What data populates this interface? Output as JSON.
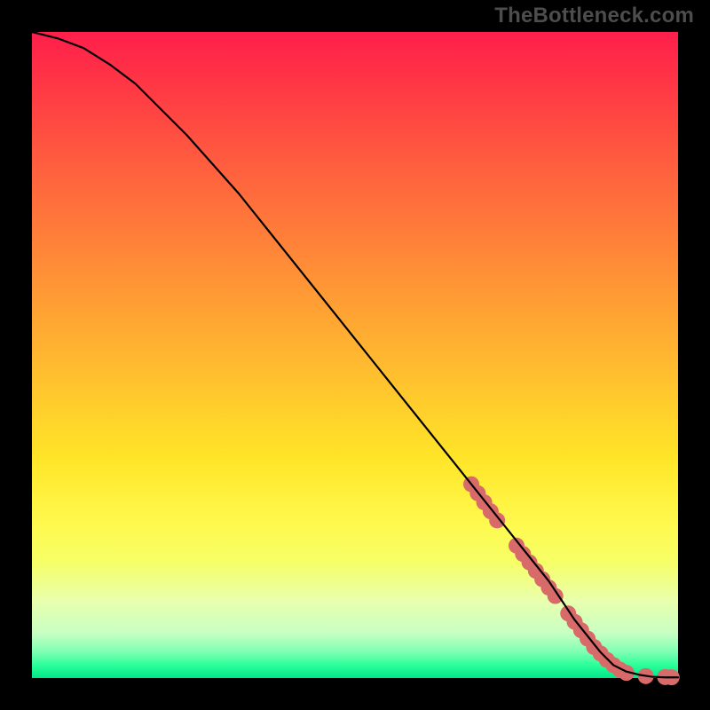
{
  "watermark": "TheBottleneck.com",
  "chart_data": {
    "type": "line",
    "title": "",
    "xlabel": "",
    "ylabel": "",
    "xlim": [
      0,
      100
    ],
    "ylim": [
      0,
      100
    ],
    "grid": false,
    "legend": false,
    "series": [
      {
        "name": "bottleneck-curve",
        "x": [
          0,
          4,
          8,
          12,
          16,
          20,
          24,
          28,
          32,
          36,
          40,
          44,
          48,
          52,
          56,
          60,
          64,
          68,
          72,
          76,
          80,
          82,
          84,
          86,
          88,
          90,
          92,
          94,
          96,
          98,
          100
        ],
        "values": [
          100,
          99,
          97.5,
          95,
          92,
          88,
          84,
          79.5,
          75,
          70,
          65,
          60,
          55,
          50,
          45,
          40,
          35,
          30,
          25,
          20,
          15,
          12,
          9,
          6.5,
          4,
          2,
          1,
          0.5,
          0.2,
          0.1,
          0.1
        ]
      }
    ],
    "markers": [
      {
        "name": "highlight-cluster",
        "x": 68,
        "y": 30
      },
      {
        "name": "highlight-cluster",
        "x": 69,
        "y": 28.6
      },
      {
        "name": "highlight-cluster",
        "x": 70,
        "y": 27.2
      },
      {
        "name": "highlight-cluster",
        "x": 71,
        "y": 25.8
      },
      {
        "name": "highlight-cluster",
        "x": 72,
        "y": 24.4
      },
      {
        "name": "highlight-cluster",
        "x": 75,
        "y": 20.5
      },
      {
        "name": "highlight-cluster",
        "x": 76,
        "y": 19.2
      },
      {
        "name": "highlight-cluster",
        "x": 77,
        "y": 17.9
      },
      {
        "name": "highlight-cluster",
        "x": 78,
        "y": 16.6
      },
      {
        "name": "highlight-cluster",
        "x": 79,
        "y": 15.3
      },
      {
        "name": "highlight-cluster",
        "x": 80,
        "y": 14
      },
      {
        "name": "highlight-cluster",
        "x": 81,
        "y": 12.7
      },
      {
        "name": "highlight-cluster",
        "x": 83,
        "y": 10
      },
      {
        "name": "highlight-cluster",
        "x": 84,
        "y": 8.7
      },
      {
        "name": "highlight-cluster",
        "x": 85,
        "y": 7.4
      },
      {
        "name": "highlight-cluster",
        "x": 86,
        "y": 6.1
      },
      {
        "name": "highlight-cluster",
        "x": 87,
        "y": 4.8
      },
      {
        "name": "highlight-cluster",
        "x": 88,
        "y": 3.8
      },
      {
        "name": "highlight-cluster",
        "x": 89,
        "y": 2.8
      },
      {
        "name": "highlight-cluster",
        "x": 90,
        "y": 2
      },
      {
        "name": "highlight-cluster",
        "x": 91,
        "y": 1.3
      },
      {
        "name": "highlight-cluster",
        "x": 92,
        "y": 0.8
      },
      {
        "name": "highlight-cluster",
        "x": 95,
        "y": 0.3
      },
      {
        "name": "highlight-cluster",
        "x": 98,
        "y": 0.15
      },
      {
        "name": "highlight-cluster",
        "x": 99,
        "y": 0.12
      }
    ],
    "marker_style": {
      "color": "#d86a6a",
      "radius_px": 9
    }
  }
}
